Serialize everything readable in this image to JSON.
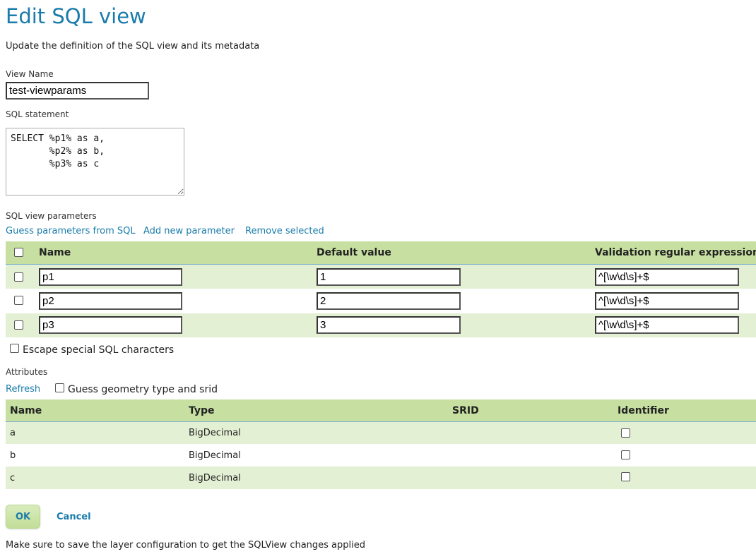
{
  "header": {
    "title": "Edit SQL view",
    "subtitle": "Update the definition of the SQL view and its metadata"
  },
  "view_name": {
    "label": "View Name",
    "value": "test-viewparams"
  },
  "sql": {
    "label": "SQL statement",
    "value": "SELECT %p1% as a,\n       %p2% as b,\n       %p3% as c"
  },
  "parameters": {
    "label": "SQL view parameters",
    "links": {
      "guess": "Guess parameters from SQL",
      "add": "Add new parameter",
      "remove": "Remove selected"
    },
    "columns": [
      "Name",
      "Default value",
      "Validation regular expression"
    ],
    "rows": [
      {
        "name": "p1",
        "default": "1",
        "regex": "^[\\w\\d\\s]+$"
      },
      {
        "name": "p2",
        "default": "2",
        "regex": "^[\\w\\d\\s]+$"
      },
      {
        "name": "p3",
        "default": "3",
        "regex": "^[\\w\\d\\s]+$"
      }
    ],
    "escape_label": "Escape special SQL characters"
  },
  "attributes": {
    "label": "Attributes",
    "refresh": "Refresh",
    "guess_geometry": "Guess geometry type and srid",
    "columns": [
      "Name",
      "Type",
      "SRID",
      "Identifier"
    ],
    "rows": [
      {
        "name": "a",
        "type": "BigDecimal",
        "srid": ""
      },
      {
        "name": "b",
        "type": "BigDecimal",
        "srid": ""
      },
      {
        "name": "c",
        "type": "BigDecimal",
        "srid": ""
      }
    ]
  },
  "actions": {
    "ok": "OK",
    "cancel": "Cancel"
  },
  "footer_note": "Make sure to save the layer configuration to get the SQLView changes applied",
  "colors": {
    "accent": "#1a7cab",
    "header_green": "#c7e0a1",
    "row_green": "#e4f0d4"
  }
}
